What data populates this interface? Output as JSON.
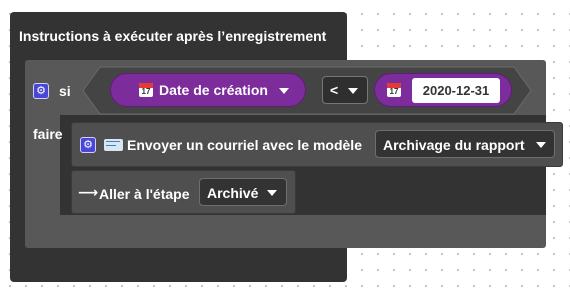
{
  "block": {
    "title": "Instructions à exécuter après l’enregistrement"
  },
  "if_block": {
    "if_label": "si",
    "do_label": "faire",
    "condition": {
      "field": "Date de création",
      "operator": "<",
      "date_value": "2020-12-31",
      "calendar_icon_text": "17"
    }
  },
  "send_email": {
    "label": "Envoyer un courriel avec le modèle",
    "template": "Archivage du rapport"
  },
  "goto_step": {
    "label": "Aller à l'étape",
    "step": "Archivé"
  },
  "icons": {
    "gear": "gear-icon",
    "calendar": "calendar-icon",
    "email": "email-icon",
    "arrow": "arrow-right-icon"
  },
  "colors": {
    "outer_block": "#333333",
    "if_block": "#585858",
    "pill": "#7d2c9c",
    "gear": "#4a47d6"
  }
}
